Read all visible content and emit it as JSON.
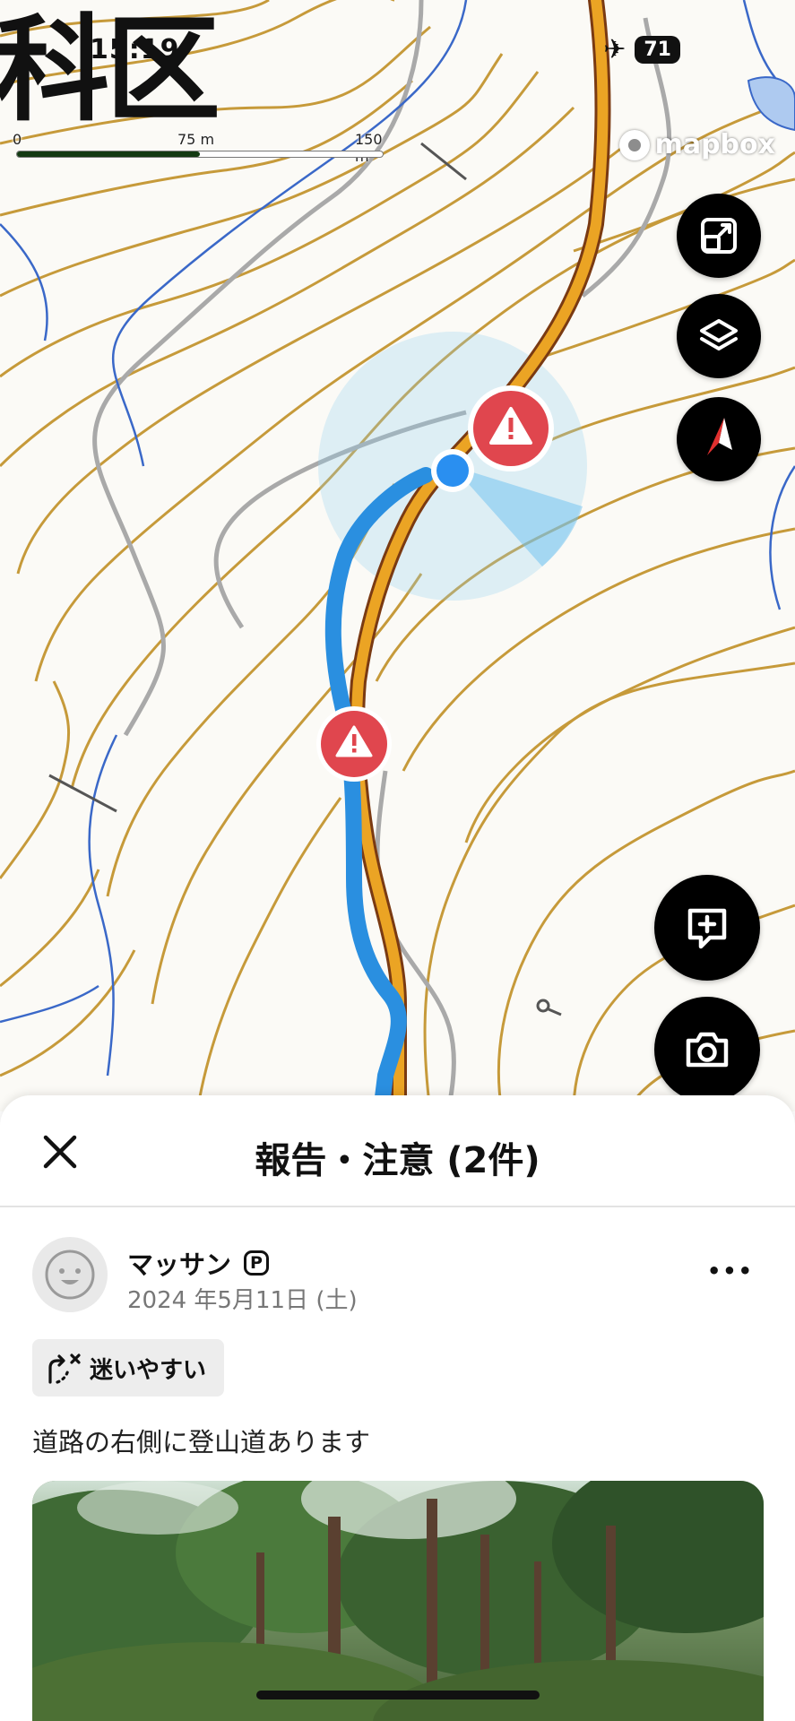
{
  "status_bar": {
    "time": "15:19",
    "battery": "71",
    "airplane_icon": "airplane-icon"
  },
  "map": {
    "place_label": "科区",
    "scale": {
      "labels": [
        "0",
        "75 m",
        "150 m"
      ],
      "fill_fraction": 0.5
    },
    "attribution": "mapbox",
    "colors": {
      "contour": "#c69a3a",
      "path_gray": "#a9a9a9",
      "stream": "#3a68c8",
      "user_track": "#2a8fe0",
      "trail": "#eba424",
      "warning": "#e0464e",
      "location_dot": "#2a8ff0"
    },
    "controls": {
      "expand_icon": "expand-icon",
      "layers_icon": "layers-icon",
      "compass_icon": "compass-icon",
      "add_report_icon": "add-report-icon",
      "camera_icon": "camera-icon"
    }
  },
  "sheet": {
    "title": "報告・注意 (2件)",
    "close_icon": "close-icon",
    "post": {
      "username": "マッサン",
      "badge": "P",
      "date": "2024 年5月11日 (土)",
      "more": "•••",
      "tag": "迷いやすい",
      "tag_icon": "lost-path-icon",
      "text": "道路の右側に登山道あります"
    }
  }
}
